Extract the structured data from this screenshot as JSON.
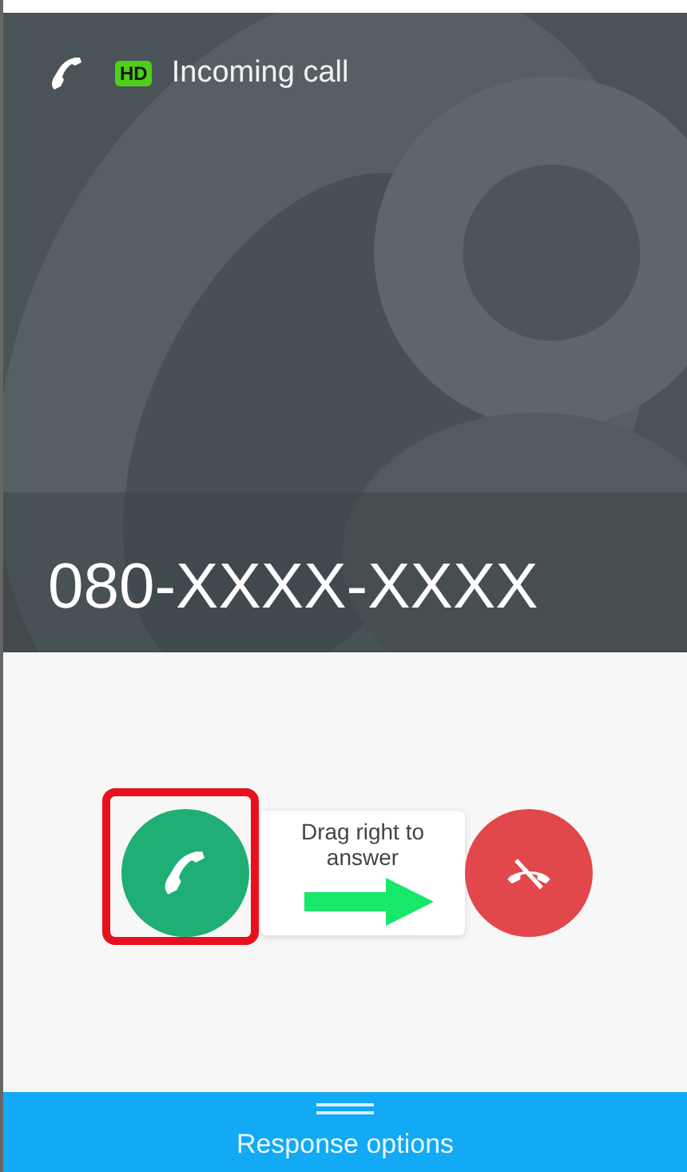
{
  "status": {
    "label": "Incoming call",
    "hd_badge": "HD"
  },
  "caller": {
    "number": "080-XXXX-XXXX"
  },
  "answer_slider": {
    "hint": "Drag right to answer"
  },
  "bottom_bar": {
    "label": "Response options"
  }
}
